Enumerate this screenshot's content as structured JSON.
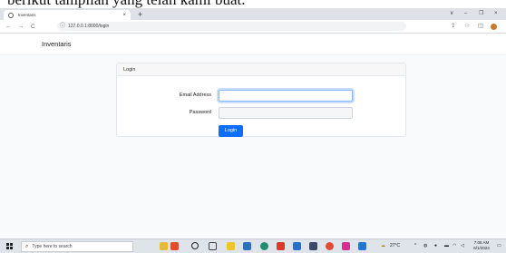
{
  "caption": {
    "text": "berikut tampilan yang telah kami buat."
  },
  "browser": {
    "tab_title": "Inventaris",
    "tab_close": "×",
    "new_tab": "+",
    "window_controls": [
      "∨",
      "–",
      "❐",
      "×"
    ],
    "url": "127.0.0.1:8000/login",
    "nav": {
      "back": "←",
      "forward": "→",
      "reload": "C",
      "info": "ⓘ"
    },
    "toolbar_icons": [
      "share-icon",
      "star-icon",
      "sidepanel-icon",
      "profile-icon"
    ]
  },
  "app": {
    "brand": "Inventaris",
    "card": {
      "header": "Login",
      "email_label": "Email Address",
      "email_value": "",
      "password_label": "Password",
      "password_value": "",
      "button_label": "Login"
    }
  },
  "taskbar": {
    "search_placeholder": "Type here to search",
    "weather": "27°C",
    "time": "7:06 AM",
    "date": "6/1/2023",
    "colors": {
      "primary_button": "#0d6efd",
      "focus_border": "#86b7fe"
    }
  }
}
